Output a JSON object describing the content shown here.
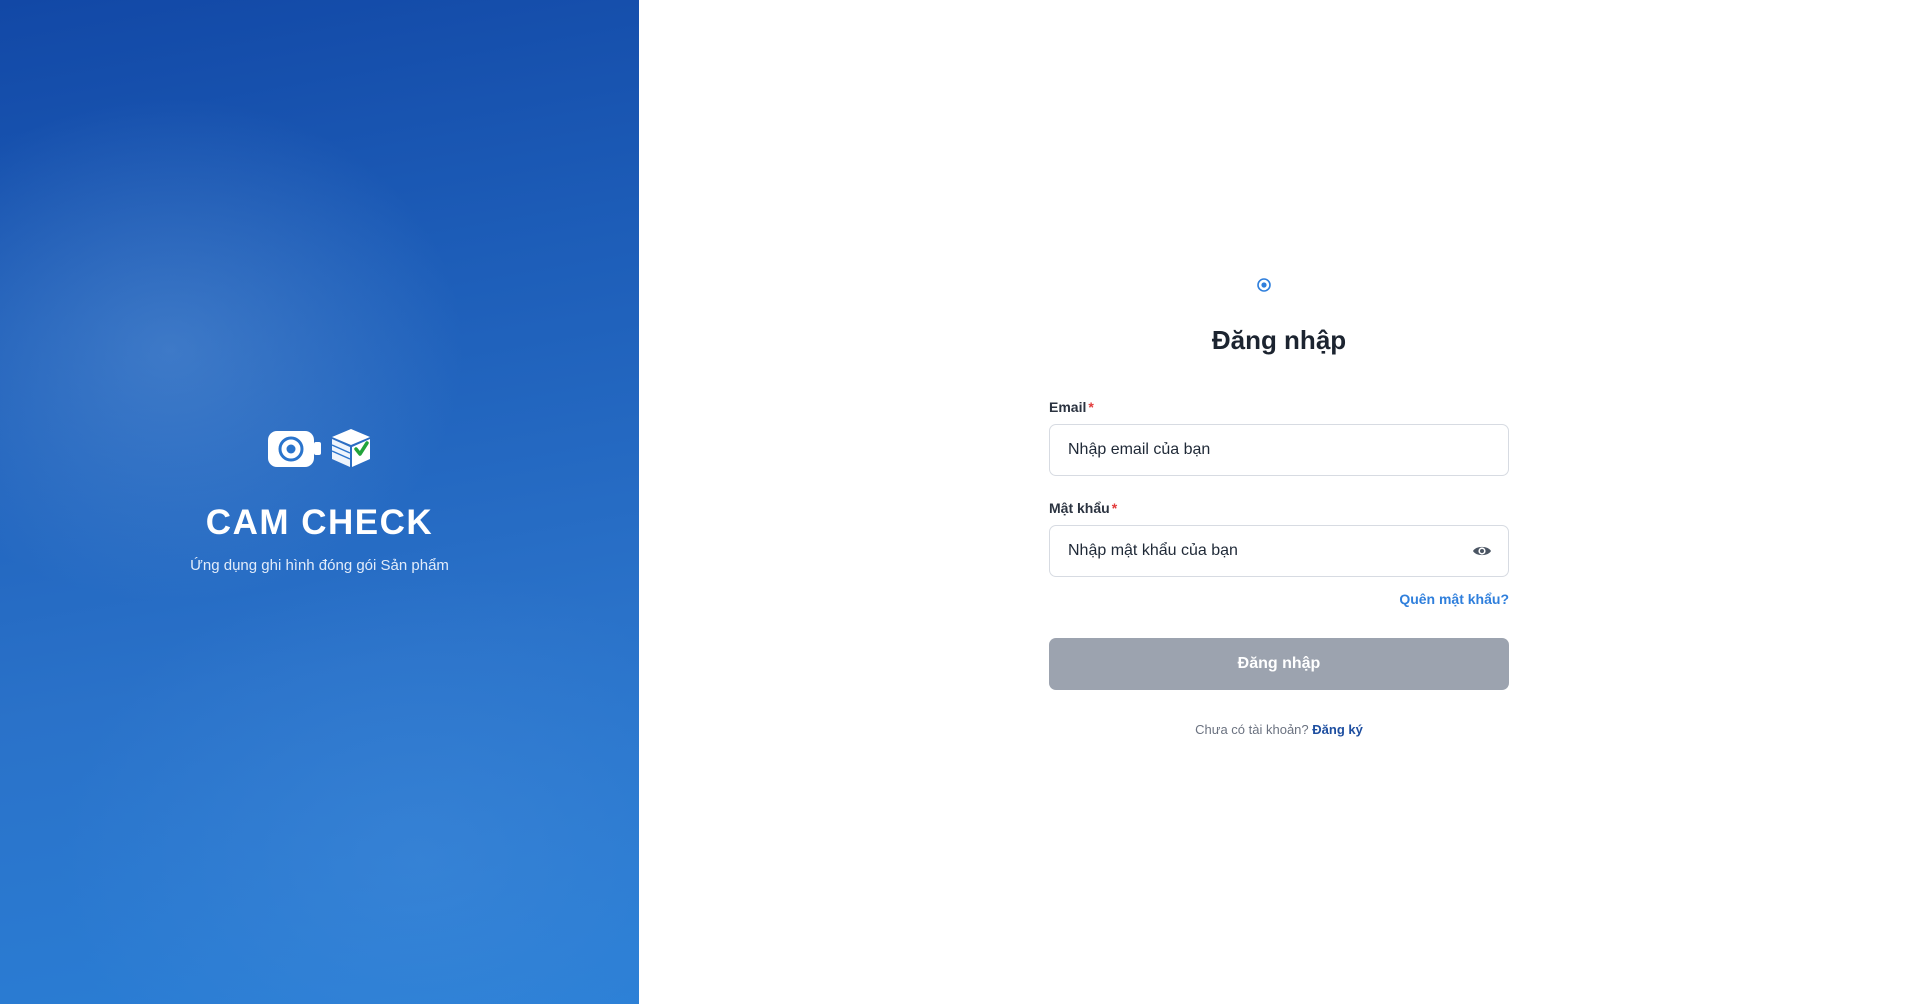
{
  "brand": {
    "title": "CAM CHECK",
    "subtitle": "Ứng dụng ghi hình đóng gói Sản phẩm",
    "logo_icons": [
      "camera-icon",
      "package-check-icon"
    ]
  },
  "login": {
    "top_icon": "target-icon",
    "title": "Đăng nhập",
    "email_label": "Email",
    "email_placeholder": "Nhập email của bạn",
    "password_label": "Mật khẩu",
    "password_placeholder": "Nhập mật khẩu của bạn",
    "required_mark": "*",
    "forgot_password": "Quên mật khẩu?",
    "submit_label": "Đăng nhập",
    "no_account_text": "Chưa có tài khoản?",
    "signup_link": "Đăng ký"
  },
  "colors": {
    "panel_gradient_top": "#1248a6",
    "panel_gradient_bottom": "#2a7fd6",
    "link": "#2f7fdc",
    "signup_link": "#1d4ea0",
    "required": "#e23b3b",
    "button_disabled": "#9ca3af",
    "title_text": "#1c2430"
  }
}
